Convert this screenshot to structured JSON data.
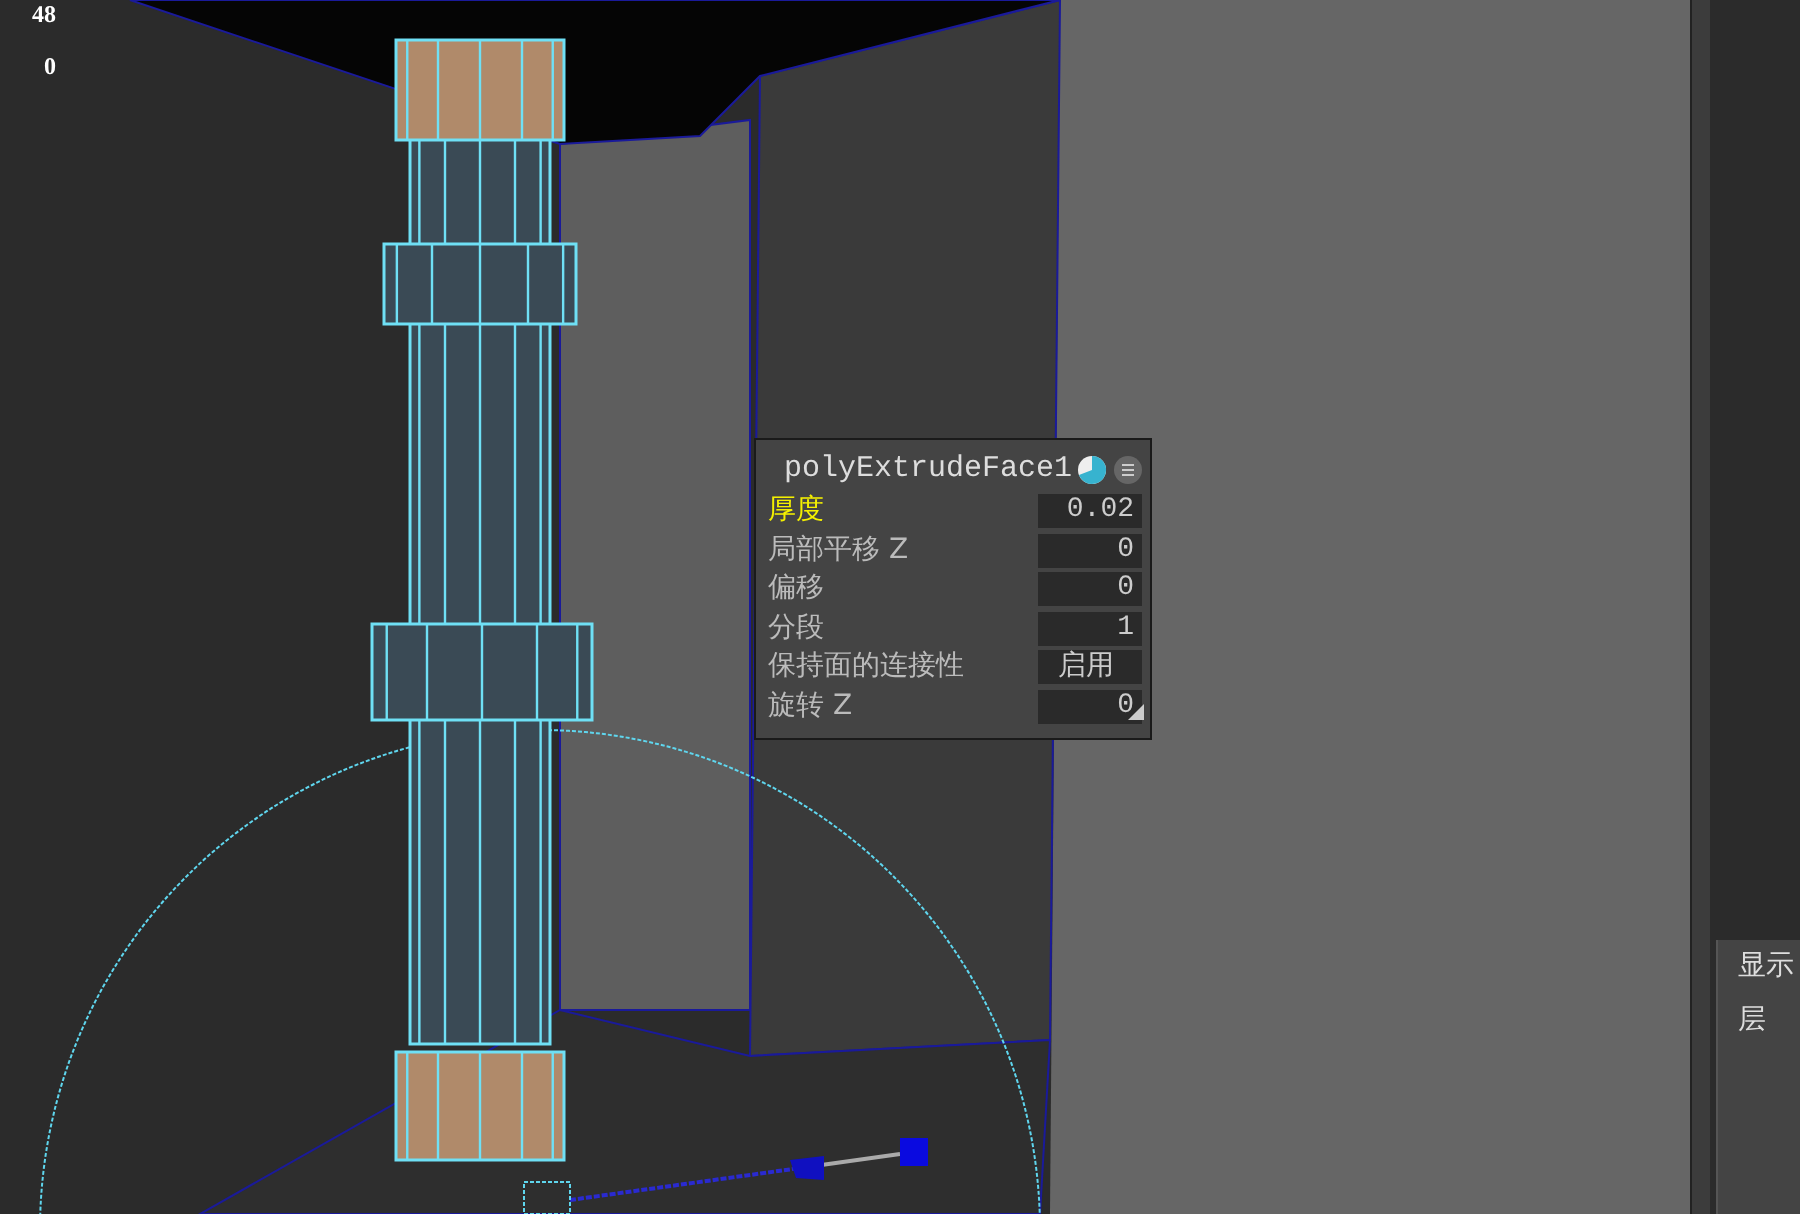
{
  "hud": {
    "lines": [
      "48",
      "0"
    ]
  },
  "attribute_popup": {
    "title": "polyExtrudeFace1",
    "rows": [
      {
        "label": "厚度",
        "value": "0.02",
        "selected": true
      },
      {
        "label": "局部平移 Z",
        "value": "0",
        "selected": false
      },
      {
        "label": "偏移",
        "value": "0",
        "selected": false
      },
      {
        "label": "分段",
        "value": "1",
        "selected": false
      },
      {
        "label": "保持面的连接性",
        "value": "启用",
        "selected": false
      },
      {
        "label": "旋转 Z",
        "value": "0",
        "selected": false
      }
    ]
  },
  "side_panel": {
    "menu_items": [
      "显示",
      "层"
    ]
  }
}
